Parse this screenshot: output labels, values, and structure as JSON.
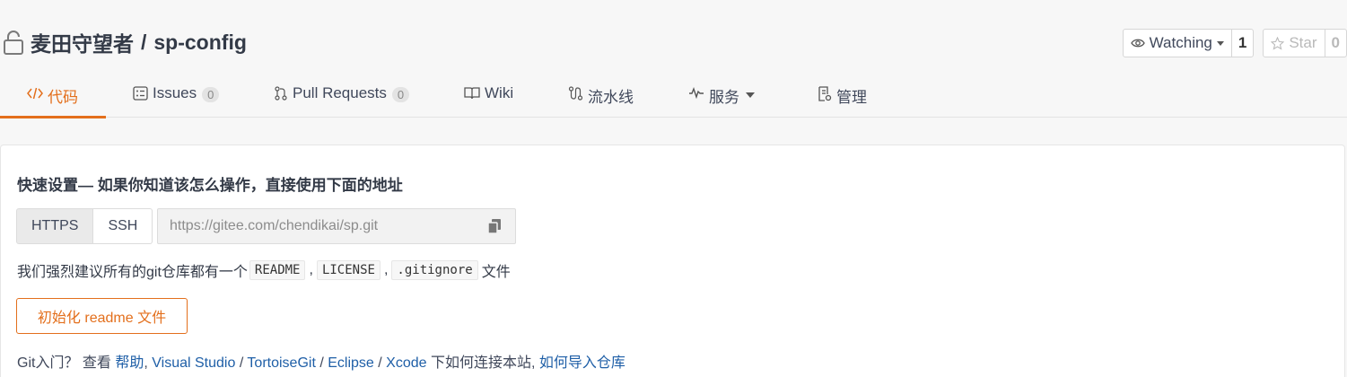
{
  "repo": {
    "owner": "麦田守望者",
    "separator": "/",
    "name": "sp-config"
  },
  "actions": {
    "watch": {
      "label": "Watching",
      "count": "1"
    },
    "star": {
      "label": "Star",
      "count": "0"
    }
  },
  "tabs": [
    {
      "label": "代码"
    },
    {
      "label": "Issues",
      "badge": "0"
    },
    {
      "label": "Pull Requests",
      "badge": "0"
    },
    {
      "label": "Wiki"
    },
    {
      "label": "流水线"
    },
    {
      "label": "服务"
    },
    {
      "label": "管理"
    }
  ],
  "quick_setup": {
    "title": "快速设置— 如果你知道该怎么操作，直接使用下面的地址",
    "protocols": [
      "HTTPS",
      "SSH"
    ],
    "url": "https://gitee.com/chendikai/sp.git",
    "recommend_prefix": "我们强烈建议所有的git仓库都有一个",
    "files": [
      "README",
      "LICENSE",
      ".gitignore"
    ],
    "recommend_suffix": "文件",
    "init_button": "初始化 readme 文件"
  },
  "git_help": {
    "prefix": "Git入门？ 查看",
    "help": "帮助",
    "vs": "Visual Studio",
    "tortoise": "TortoiseGit",
    "eclipse": "Eclipse",
    "xcode": "Xcode",
    "connect_text": "下如何连接本站,",
    "import": "如何导入仓库"
  }
}
